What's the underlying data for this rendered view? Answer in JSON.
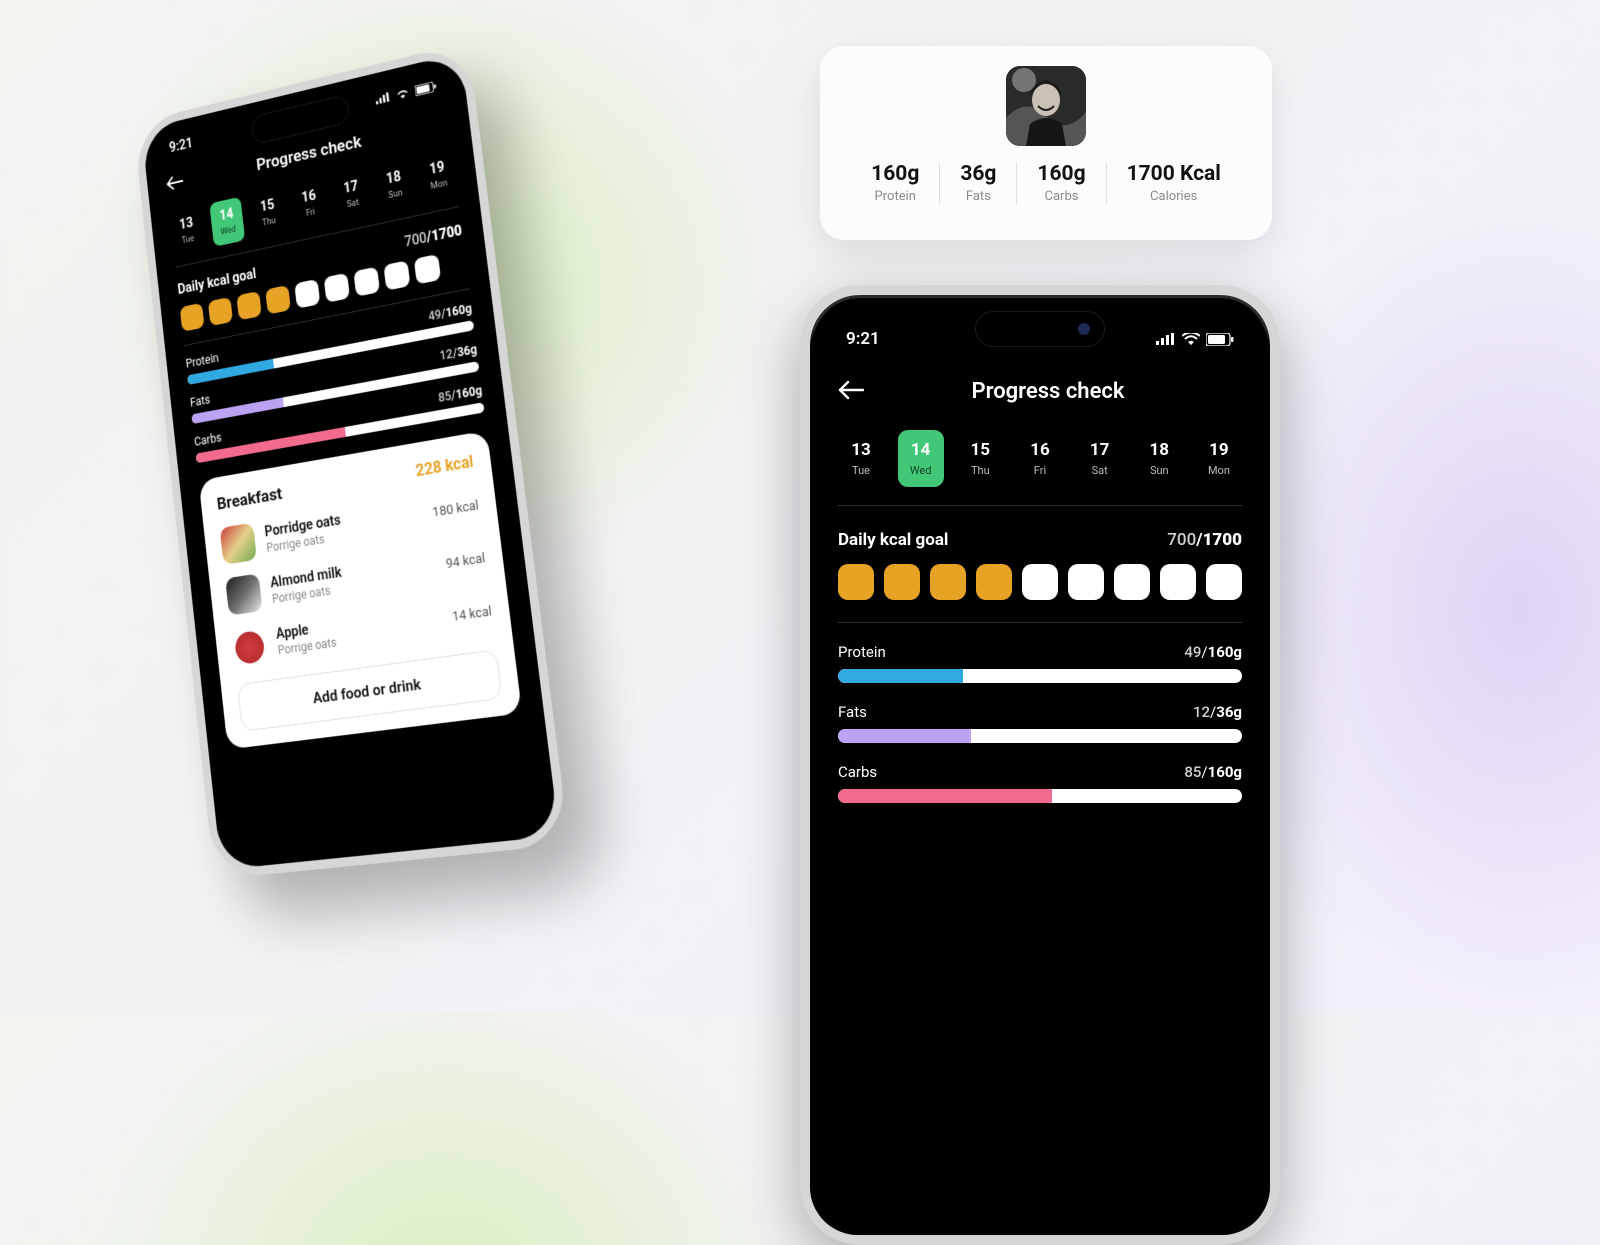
{
  "statusbar": {
    "time": "9:21"
  },
  "header": {
    "title": "Progress check"
  },
  "days": [
    {
      "num": "13",
      "dow": "Tue",
      "active": false
    },
    {
      "num": "14",
      "dow": "Wed",
      "active": true
    },
    {
      "num": "15",
      "dow": "Thu",
      "active": false
    },
    {
      "num": "16",
      "dow": "Fri",
      "active": false
    },
    {
      "num": "17",
      "dow": "Sat",
      "active": false
    },
    {
      "num": "18",
      "dow": "Sun",
      "active": false
    },
    {
      "num": "19",
      "dow": "Mon",
      "active": false
    }
  ],
  "goal": {
    "label": "Daily kcal goal",
    "current": "700",
    "sep": "/",
    "target": "1700",
    "filled": 4,
    "total": 9
  },
  "macros": {
    "protein": {
      "label": "Protein",
      "current": "49",
      "sep": "/",
      "target": "160g",
      "pct": 31,
      "color": "#2fa9e0"
    },
    "fats": {
      "label": "Fats",
      "current": "12",
      "sep": "/",
      "target": "36g",
      "pct": 33,
      "color": "#b9a3f2"
    },
    "carbs": {
      "label": "Carbs",
      "current": "85",
      "sep": "/",
      "target": "160g",
      "pct": 53,
      "color": "#f36a8f"
    }
  },
  "meal": {
    "name": "Breakfast",
    "total": "228 kcal",
    "items": [
      {
        "name": "Porridge oats",
        "sub": "Porrige oats",
        "cal": "180 kcal",
        "thumb_css": "linear-gradient(135deg,#c93b3b,#e6d08a,#6faa4f)"
      },
      {
        "name": "Almond milk",
        "sub": "Porrige oats",
        "cal": "94 kcal",
        "thumb_css": "linear-gradient(135deg,#1d1d1d,#6d6d6d,#e8e7e3)"
      },
      {
        "name": "Apple",
        "sub": "Porrige oats",
        "cal": "14 kcal",
        "thumb_css": "radial-gradient(circle at 50% 55%,#d33d3f 0%,#b82e31 55%,#fff 58%)"
      }
    ],
    "add_label": "Add food or drink"
  },
  "summary": {
    "stats": [
      {
        "value": "160g",
        "label": "Protein"
      },
      {
        "value": "36g",
        "label": "Fats"
      },
      {
        "value": "160g",
        "label": "Carbs"
      },
      {
        "value": "1700 Kcal",
        "label": "Calories"
      }
    ]
  }
}
